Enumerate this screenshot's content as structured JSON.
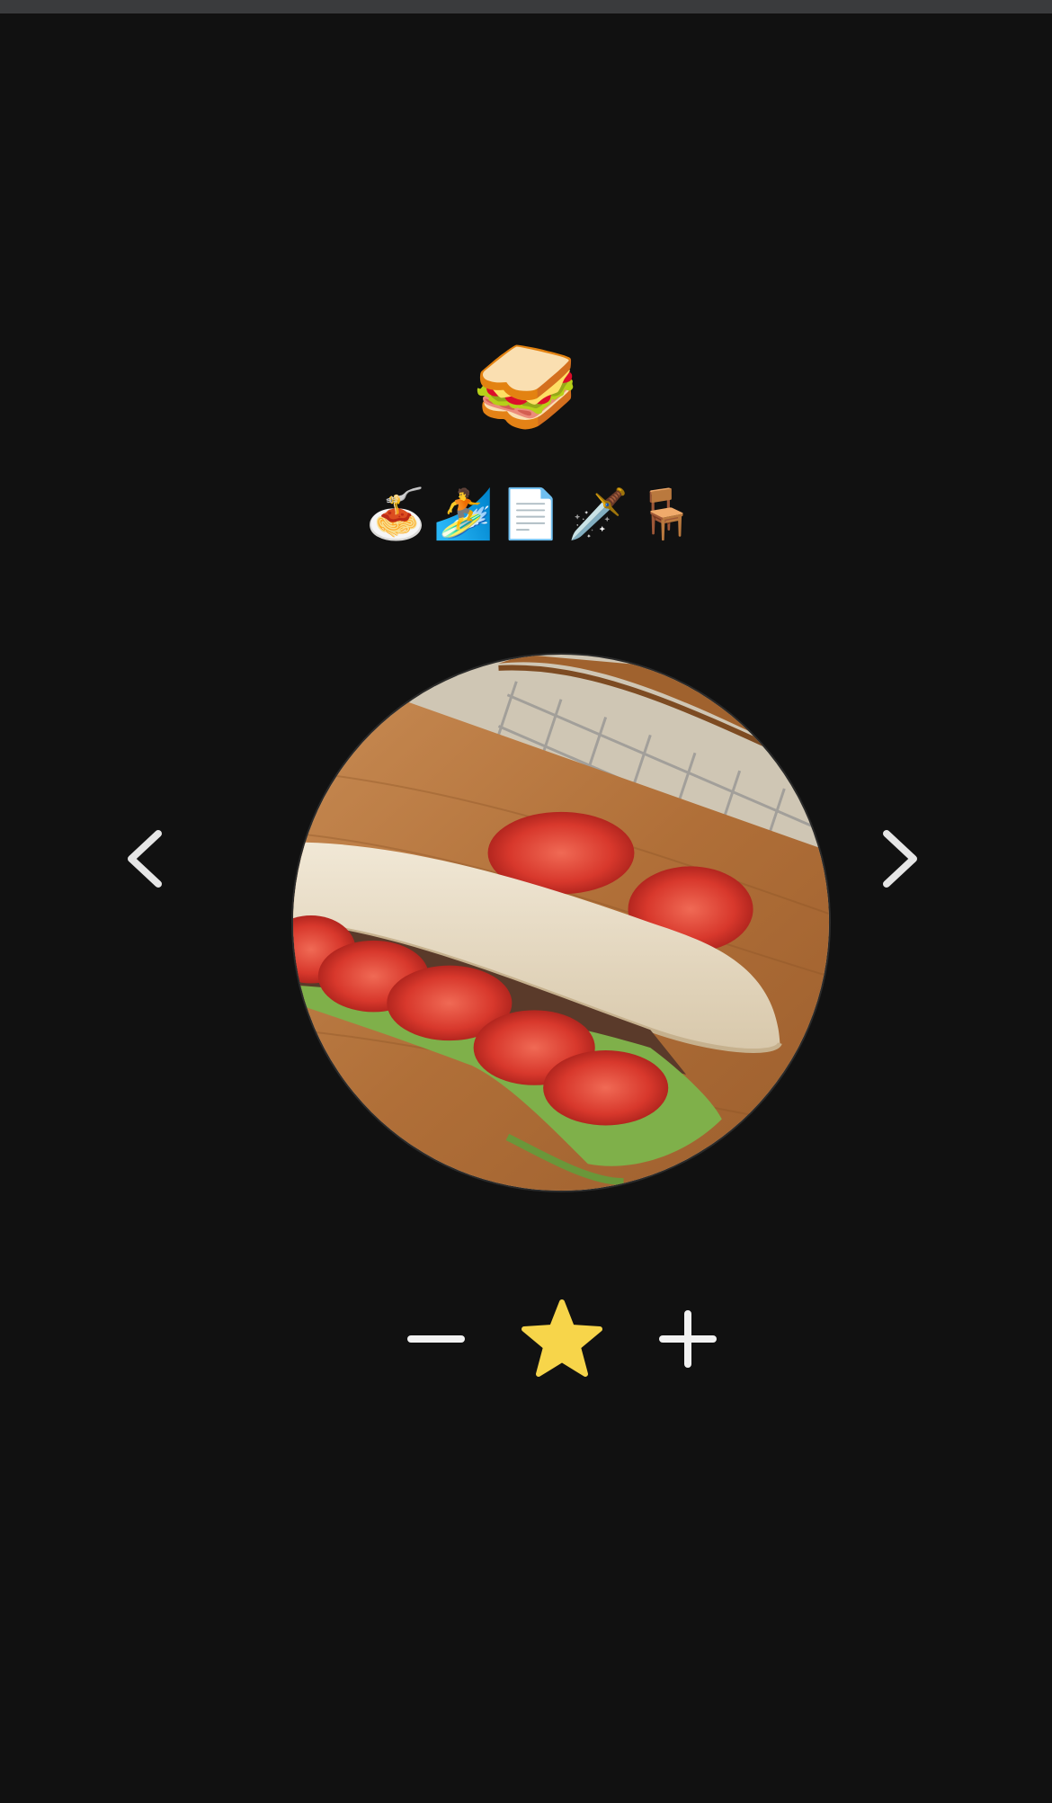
{
  "main_emoji": "🥪",
  "emoji_options": [
    {
      "emoji": "🍝",
      "name": "spaghetti"
    },
    {
      "emoji": "🏄",
      "name": "surfer"
    },
    {
      "emoji": "📄",
      "name": "page"
    },
    {
      "emoji": "🗡️",
      "name": "dagger"
    },
    {
      "emoji": "🪑",
      "name": "chair"
    }
  ],
  "photo": {
    "subject": "sandwich on cutting board",
    "colors": {
      "board": "#b0703a",
      "bread": "#e9ddc6",
      "tomato": "#d8382c",
      "lettuce": "#7fb04a"
    }
  },
  "navigation": {
    "prev_icon": "chevron-left-icon",
    "next_icon": "chevron-right-icon",
    "color": "#e6e6e6"
  },
  "rating": {
    "minus_icon": "minus-icon",
    "star_icon": "star-icon",
    "plus_icon": "plus-icon",
    "star_color": "#f7d54a",
    "control_color": "#f2f2f2"
  }
}
